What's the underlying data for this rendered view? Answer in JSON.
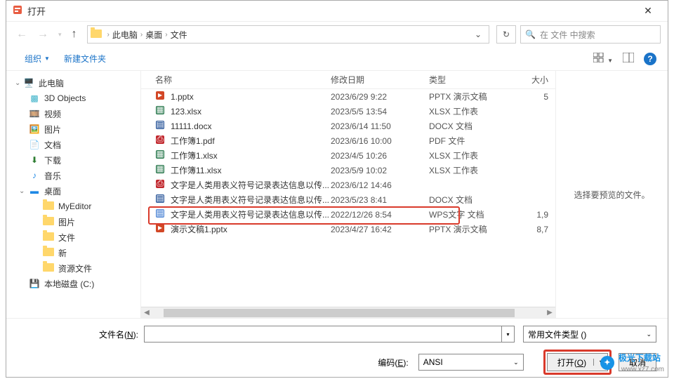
{
  "title": "打开",
  "breadcrumb": {
    "root": "此电脑",
    "p1": "桌面",
    "p2": "文件"
  },
  "search_placeholder": "在 文件 中搜索",
  "toolbar": {
    "organize": "组织",
    "newfolder": "新建文件夹"
  },
  "columns": {
    "name": "名称",
    "date": "修改日期",
    "type": "类型",
    "size": "大小"
  },
  "tree": {
    "pc": "此电脑",
    "d3d": "3D Objects",
    "video": "视频",
    "pic": "图片",
    "doc": "文档",
    "dl": "下载",
    "music": "音乐",
    "desktop": "桌面",
    "myeditor": "MyEditor",
    "tpic": "图片",
    "tfile": "文件",
    "tnew": "新",
    "tres": "资源文件",
    "cdrive": "本地磁盘 (C:)"
  },
  "files": [
    {
      "name": "1.pptx",
      "date": "2023/6/29 9:22",
      "type": "PPTX 演示文稿",
      "size": "5",
      "icon": "pptx"
    },
    {
      "name": "123.xlsx",
      "date": "2023/5/5 13:54",
      "type": "XLSX 工作表",
      "size": "",
      "icon": "xlsx"
    },
    {
      "name": "11111.docx",
      "date": "2023/6/14 11:50",
      "type": "DOCX 文档",
      "size": "",
      "icon": "docx"
    },
    {
      "name": "工作簿1.pdf",
      "date": "2023/6/16 10:00",
      "type": "PDF 文件",
      "size": "",
      "icon": "pdf"
    },
    {
      "name": "工作簿1.xlsx",
      "date": "2023/4/5 10:26",
      "type": "XLSX 工作表",
      "size": "",
      "icon": "xlsx"
    },
    {
      "name": "工作簿11.xlsx",
      "date": "2023/5/9 10:02",
      "type": "XLSX 工作表",
      "size": "",
      "icon": "xlsx"
    },
    {
      "name": "文字是人类用表义符号记录表达信息以传...",
      "date": "2023/6/12 14:46",
      "type": "",
      "size": "",
      "icon": "pdf"
    },
    {
      "name": "文字是人类用表义符号记录表达信息以传...",
      "date": "2023/5/23 8:41",
      "type": "DOCX 文档",
      "size": "",
      "icon": "docx"
    },
    {
      "name": "文字是人类用表义符号记录表达信息以传...",
      "date": "2022/12/26 8:54",
      "type": "WPS文字 文档",
      "size": "1,9",
      "icon": "wps",
      "hl": true
    },
    {
      "name": "演示文稿1.pptx",
      "date": "2023/4/27 16:42",
      "type": "PPTX 演示文稿",
      "size": "8,7",
      "icon": "pptx"
    }
  ],
  "preview_text": "选择要预览的文件。",
  "filename_label": "文件名(N):",
  "filetype_label": "常用文件类型 ()",
  "encoding_label": "编码(E):",
  "encoding_value": "ANSI",
  "open_btn": "打开(O)",
  "cancel_btn": "取消",
  "watermark": {
    "name": "极光下载站",
    "url": "www.xz7.com"
  }
}
